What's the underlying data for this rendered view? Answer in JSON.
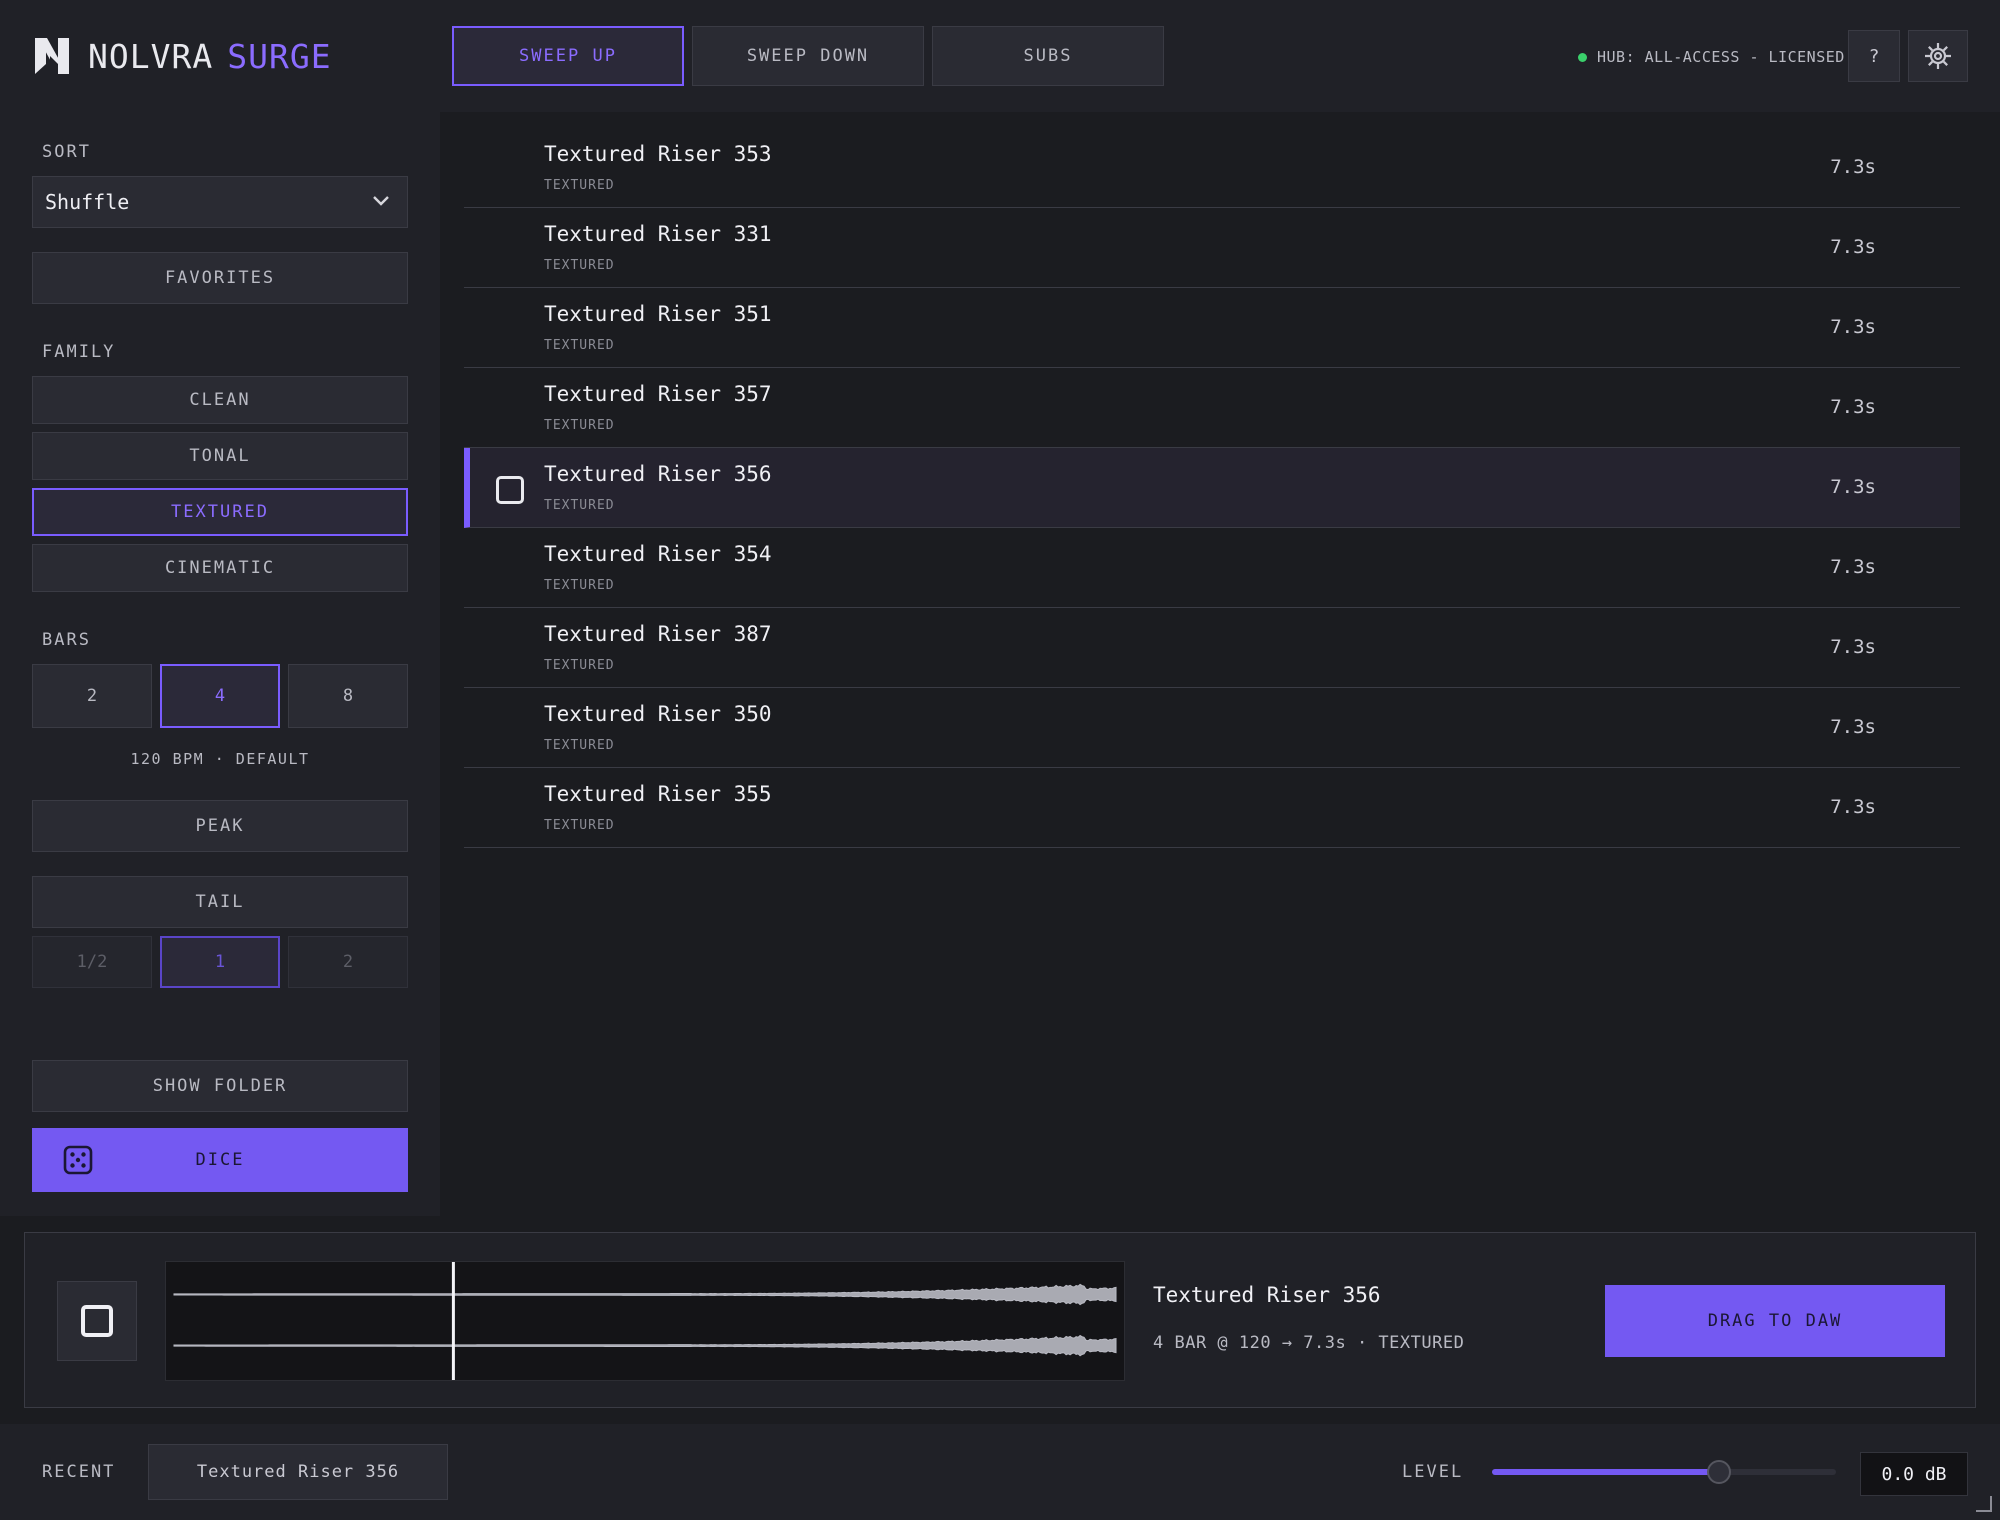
{
  "brand": {
    "name": "NOLVRA",
    "product": "SURGE",
    "logo_icon": "nolvra-logo-icon"
  },
  "tabs": [
    {
      "label": "SWEEP UP",
      "active": true
    },
    {
      "label": "SWEEP DOWN",
      "active": false
    },
    {
      "label": "SUBS",
      "active": false
    }
  ],
  "header": {
    "license": "HUB: ALL-ACCESS - LICENSED",
    "license_status_color": "#3ad06b",
    "help_label": "?",
    "settings_icon": "gear-icon"
  },
  "sidebar": {
    "sort_label": "SORT",
    "sort_value": "Shuffle",
    "favorites_label": "FAVORITES",
    "family_label": "FAMILY",
    "family": [
      {
        "label": "CLEAN",
        "active": false
      },
      {
        "label": "TONAL",
        "active": false
      },
      {
        "label": "TEXTURED",
        "active": true
      },
      {
        "label": "CINEMATIC",
        "active": false
      }
    ],
    "bars_label": "BARS",
    "bars": [
      {
        "label": "2",
        "active": false
      },
      {
        "label": "4",
        "active": true
      },
      {
        "label": "8",
        "active": false
      }
    ],
    "bpm_note": "120 BPM · DEFAULT",
    "peak_label": "PEAK",
    "tail_label": "TAIL",
    "tail_options": [
      {
        "label": "1/2",
        "active": false
      },
      {
        "label": "1",
        "active": true
      },
      {
        "label": "2",
        "active": false
      }
    ],
    "show_folder_label": "SHOW FOLDER",
    "dice_label": "DICE",
    "dice_icon": "dice-icon"
  },
  "list": {
    "rows": [
      {
        "name": "Textured Riser 353",
        "tag": "TEXTURED",
        "duration": "7.3s",
        "selected": false
      },
      {
        "name": "Textured Riser 331",
        "tag": "TEXTURED",
        "duration": "7.3s",
        "selected": false
      },
      {
        "name": "Textured Riser 351",
        "tag": "TEXTURED",
        "duration": "7.3s",
        "selected": false
      },
      {
        "name": "Textured Riser 357",
        "tag": "TEXTURED",
        "duration": "7.3s",
        "selected": false
      },
      {
        "name": "Textured Riser 356",
        "tag": "TEXTURED",
        "duration": "7.3s",
        "selected": true
      },
      {
        "name": "Textured Riser 354",
        "tag": "TEXTURED",
        "duration": "7.3s",
        "selected": false
      },
      {
        "name": "Textured Riser 387",
        "tag": "TEXTURED",
        "duration": "7.3s",
        "selected": false
      },
      {
        "name": "Textured Riser 350",
        "tag": "TEXTURED",
        "duration": "7.3s",
        "selected": false
      },
      {
        "name": "Textured Riser 355",
        "tag": "TEXTURED",
        "duration": "7.3s",
        "selected": false
      }
    ]
  },
  "player": {
    "title": "Textured Riser 356",
    "meta": "4 BAR @ 120 → 7.3s · TEXTURED",
    "drag_label": "DRAG TO DAW",
    "playhead_fraction": 0.3
  },
  "footer": {
    "recent_label": "RECENT",
    "recent_item": "Textured Riser 356",
    "level_label": "LEVEL",
    "level_fraction": 0.66,
    "level_readout": "0.0 dB"
  },
  "colors": {
    "accent": "#7459f2",
    "accent_text": "#8b6cff",
    "background": "#1b1c20",
    "panel": "#202127"
  }
}
